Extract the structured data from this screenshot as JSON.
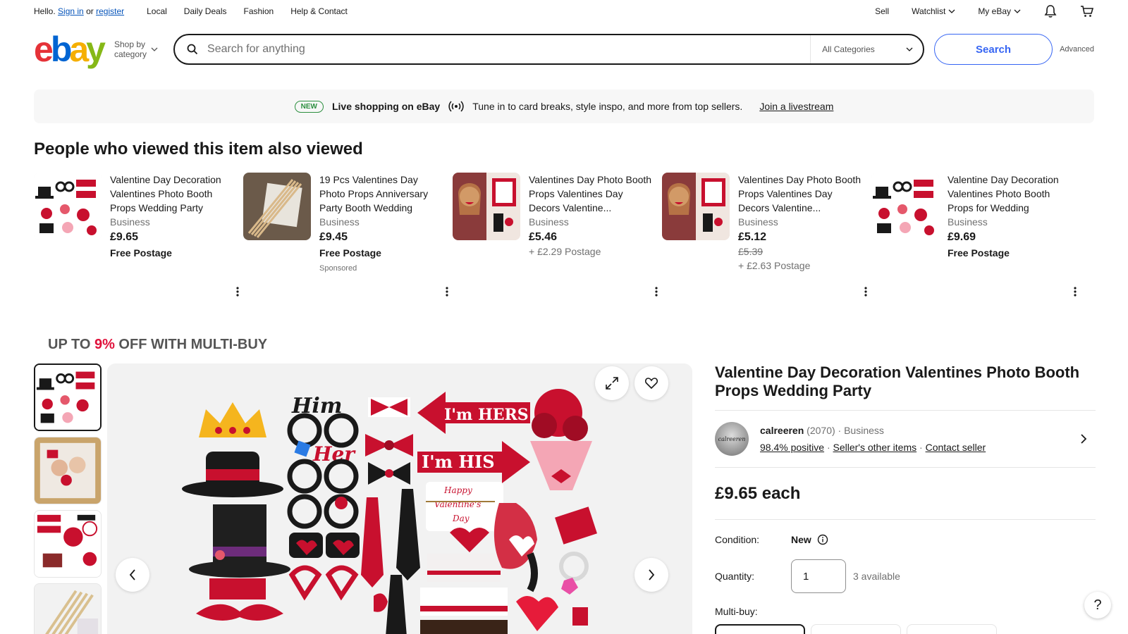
{
  "topbar": {
    "hello": "Hello.",
    "sign_in": "Sign in",
    "or": "or",
    "register": "register",
    "nav": [
      "Local",
      "Daily Deals",
      "Fashion",
      "Help & Contact"
    ],
    "sell": "Sell",
    "watchlist": "Watchlist",
    "my_ebay": "My eBay"
  },
  "header": {
    "logo_letters": [
      "e",
      "b",
      "a",
      "y"
    ],
    "shop_by": "Shop by",
    "category": "category",
    "search_placeholder": "Search for anything",
    "category_select": "All Categories",
    "search_button": "Search",
    "advanced": "Advanced"
  },
  "banner": {
    "badge": "NEW",
    "title": "Live shopping on eBay",
    "text": "Tune in to card breaks, style inspo, and more from top sellers.",
    "link": "Join a livestream"
  },
  "also_viewed": {
    "title": "People who viewed this item also viewed",
    "items": [
      {
        "title": "Valentine Day Decoration Valentines Photo Booth Props Wedding Party",
        "type": "Business",
        "price": "£9.65",
        "old_price": "",
        "shipping": "Free Postage",
        "free": true,
        "sponsored": ""
      },
      {
        "title": "19 Pcs Valentines Day Photo Props Anniversary Party Booth Wedding",
        "type": "Business",
        "price": "£9.45",
        "old_price": "",
        "shipping": "Free Postage",
        "free": true,
        "sponsored": "Sponsored"
      },
      {
        "title": "Valentines Day Photo Booth Props Valentines Day Decors Valentine...",
        "type": "Business",
        "price": "£5.46",
        "old_price": "",
        "shipping": "+ £2.29 Postage",
        "free": false,
        "sponsored": ""
      },
      {
        "title": "Valentines Day Photo Booth Props Valentines Day Decors Valentine...",
        "type": "Business",
        "price": "£5.12",
        "old_price": "£5.39",
        "shipping": "+ £2.63 Postage",
        "free": false,
        "sponsored": ""
      },
      {
        "title": "Valentine Day Decoration Valentines Photo Booth Props for Wedding",
        "type": "Business",
        "price": "£9.69",
        "old_price": "",
        "shipping": "Free Postage",
        "free": true,
        "sponsored": ""
      }
    ]
  },
  "promo": {
    "prefix": "UP TO",
    "percent": "9%",
    "suffix": "OFF WITH MULTI-BUY"
  },
  "gallery": {
    "sticker_texts": [
      "Him",
      "Her",
      "I'm HERS",
      "I'm HIS",
      "Happy",
      "Valentine's",
      "Day"
    ]
  },
  "product": {
    "title": "Valentine Day Decoration Valentines Photo Booth Props Wedding Party",
    "seller_name": "calreeren",
    "seller_count": "(2070)",
    "seller_type": "Business",
    "seller_positive": "98.4% positive",
    "seller_other": "Seller's other items",
    "seller_contact": "Contact seller",
    "seller_avatar_text": "calreeren",
    "price": "£9.65 each",
    "condition_label": "Condition:",
    "condition_value": "New",
    "quantity_label": "Quantity:",
    "quantity_value": "1",
    "available": "3 available",
    "multibuy_label": "Multi-buy:"
  },
  "help": "?",
  "colors": {
    "accent": "#3665f3",
    "link": "#0654ba",
    "promo_red": "#e0103a",
    "logo_red": "#e53238",
    "logo_blue": "#0064d2",
    "logo_yellow": "#f5af02",
    "logo_green": "#86b817",
    "badge_green": "#2c8f3f"
  }
}
